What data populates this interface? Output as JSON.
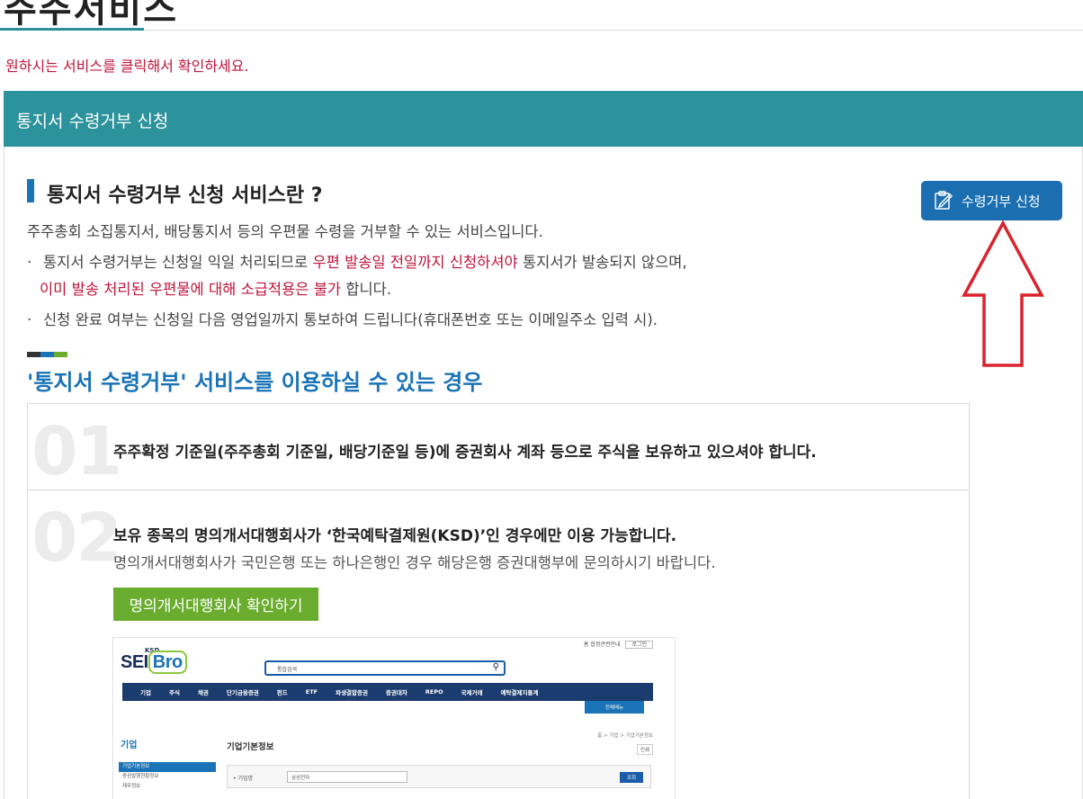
{
  "page": {
    "title": "주주서비스",
    "instruction": "원하시는 서비스를 클릭해서 확인하세요."
  },
  "section": {
    "header": "통지서 수령거부 신청",
    "heading": "통지서 수령거부 신청 서비스란 ?",
    "intro": "주주총회 소집통지서, 배당통지서 등의 우편물 수령을 거부할 수 있는 서비스입니다.",
    "bullet1_a": "통지서 수령거부는 신청일 익일 처리되므로 ",
    "bullet1_hl": "우편 발송일 전일까지 신청하셔야",
    "bullet1_b": " 통지서가 발송되지 않으며,",
    "bullet1_cont_hl": "이미 발송 처리된 우편물에 대해 소급적용은 불가",
    "bullet1_cont_b": " 합니다.",
    "bullet2": "신청 완료 여부는 신청일 다음 영업일까지 통보하여 드립니다(휴대폰번호 또는 이메일주소 입력 시).",
    "bullet_dot": "·",
    "apply_button": "수령거부 신청",
    "apply_icon": "clipboard-edit-icon",
    "conditions_heading": "'통지서 수령거부' 서비스를 이용하실 수 있는 경우",
    "conditions": [
      {
        "num": "01",
        "text": "주주확정 기준일(주주총회 기준일, 배당기준일 등)에 증권회사 계좌 등으로 주식을 보유하고 있으셔야 합니다."
      },
      {
        "num": "02",
        "text": "보유 종목의 명의개서대행회사가 ‘한국예탁결제원(KSD)’인 경우에만 이용 가능합니다.",
        "sub": "명의개서대행회사가 국민은행 또는 하나은행인 경우 해당은행 증권대행부에 문의하시기 바랍니다.",
        "button": "명의개서대행회사 확인하기"
      }
    ]
  },
  "embedded": {
    "logo_a": "SEI",
    "logo_b": "Bro",
    "ksd": "KSD",
    "util_link": "홈 협정관련안내",
    "util_btn": "로그인",
    "search_label": "통합검색",
    "search_icon": "magnifier-icon",
    "nav": [
      "기업",
      "주식",
      "채권",
      "단기금융증권",
      "펀드",
      "ETF",
      "파생결합증권",
      "증권대차",
      "REPO",
      "국제거래",
      "예탁결제지통계"
    ],
    "nav_all": "전체메뉴",
    "side_title": "기업",
    "side_items": [
      "기업기본정보",
      "증권발행현황정보",
      "재무정보"
    ],
    "content_title": "기업기본정보",
    "breadcrumb": "홈 > 기업 > 기업기본정보",
    "print": "인쇄",
    "field_label": "• 기업명",
    "field_value": "삼성전자",
    "go_button": "조회"
  },
  "colors": {
    "teal": "#2c929c",
    "blue": "#1b6fb0",
    "red": "#c0143c",
    "green": "#6aad2e",
    "arrow": "#d9232d"
  }
}
